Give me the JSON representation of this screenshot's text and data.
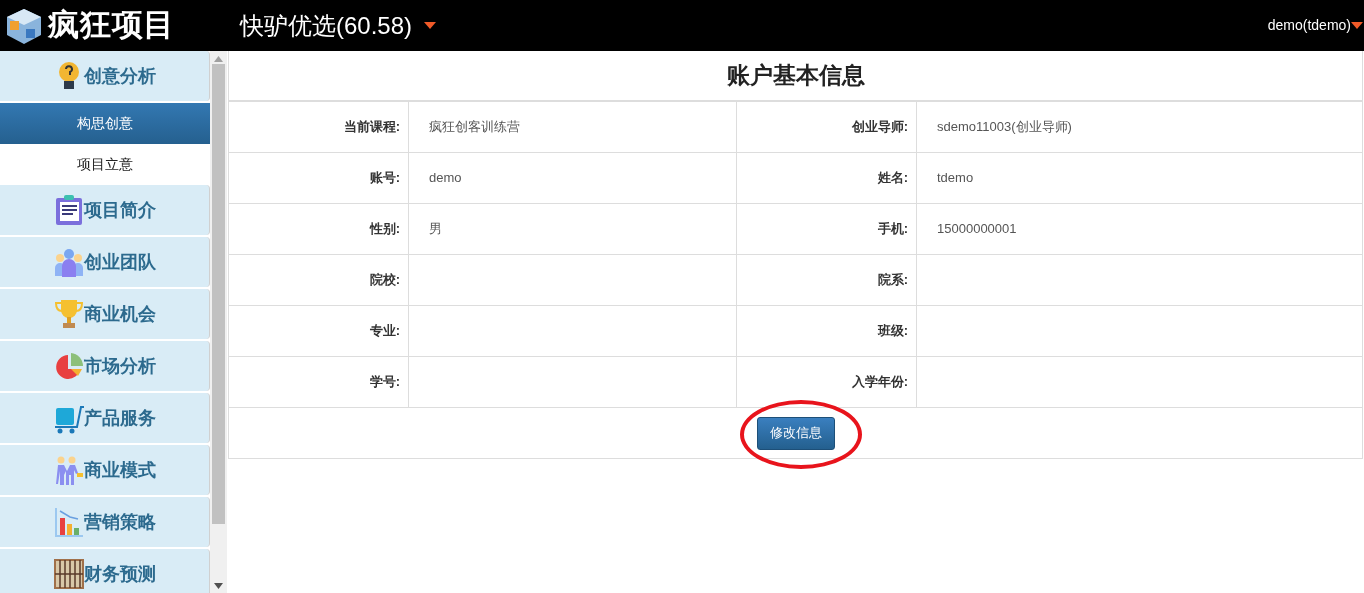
{
  "header": {
    "logo_text": "疯狂项目",
    "project": "快驴优选(60.58)",
    "user": "demo(tdemo)"
  },
  "sidebar": {
    "groups": [
      {
        "label": "创意分析",
        "children": [
          {
            "label": "构思创意",
            "selected": true
          },
          {
            "label": "项目立意",
            "selected": false
          }
        ]
      },
      {
        "label": "项目简介"
      },
      {
        "label": "创业团队"
      },
      {
        "label": "商业机会"
      },
      {
        "label": "市场分析"
      },
      {
        "label": "产品服务"
      },
      {
        "label": "商业模式"
      },
      {
        "label": "营销策略"
      },
      {
        "label": "财务预测"
      }
    ]
  },
  "account": {
    "title": "账户基本信息",
    "rows": [
      [
        {
          "label": "当前课程:",
          "value": "疯狂创客训练营"
        },
        {
          "label": "创业导师:",
          "value": "sdemo11003(创业导师)"
        }
      ],
      [
        {
          "label": "账号:",
          "value": "demo"
        },
        {
          "label": "姓名:",
          "value": "tdemo"
        }
      ],
      [
        {
          "label": "性别:",
          "value": "男"
        },
        {
          "label": "手机:",
          "value": "15000000001"
        }
      ],
      [
        {
          "label": "院校:"
        },
        {
          "label": "院系:"
        }
      ],
      [
        {
          "label": "专业:"
        },
        {
          "label": "班级:"
        }
      ],
      [
        {
          "label": "学号:"
        },
        {
          "label": "入学年份:"
        }
      ]
    ],
    "button": {
      "label": "修改信息",
      "circled": true
    }
  }
}
